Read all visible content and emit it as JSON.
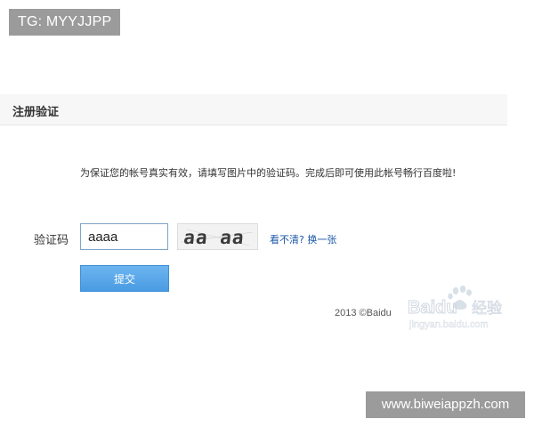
{
  "watermark_tag": {
    "text": "TG: MYYJJPP"
  },
  "header": {
    "title": "注册验证"
  },
  "instruction": {
    "text": "为保证您的帐号真实有效，请填写图片中的验证码。完成后即可使用此帐号畅行百度啦!"
  },
  "form": {
    "captcha_label": "验证码",
    "captcha_value": "aaaa",
    "captcha_image_text": "aa aa",
    "refresh_link": "看不清? 换一张",
    "submit_label": "提交"
  },
  "footer": {
    "copyright": "2013 ©Baidu"
  },
  "baidu_watermark": {
    "brand": "Baidu",
    "product": "经验",
    "url": "jingyan.baidu.com"
  },
  "site_tag": {
    "text": "www.biweiappzh.com"
  },
  "colors": {
    "button_blue": "#4a9be3",
    "link_blue": "#1a57a8",
    "input_border": "#7ea4c8",
    "tag_gray": "#9b9b9b"
  }
}
